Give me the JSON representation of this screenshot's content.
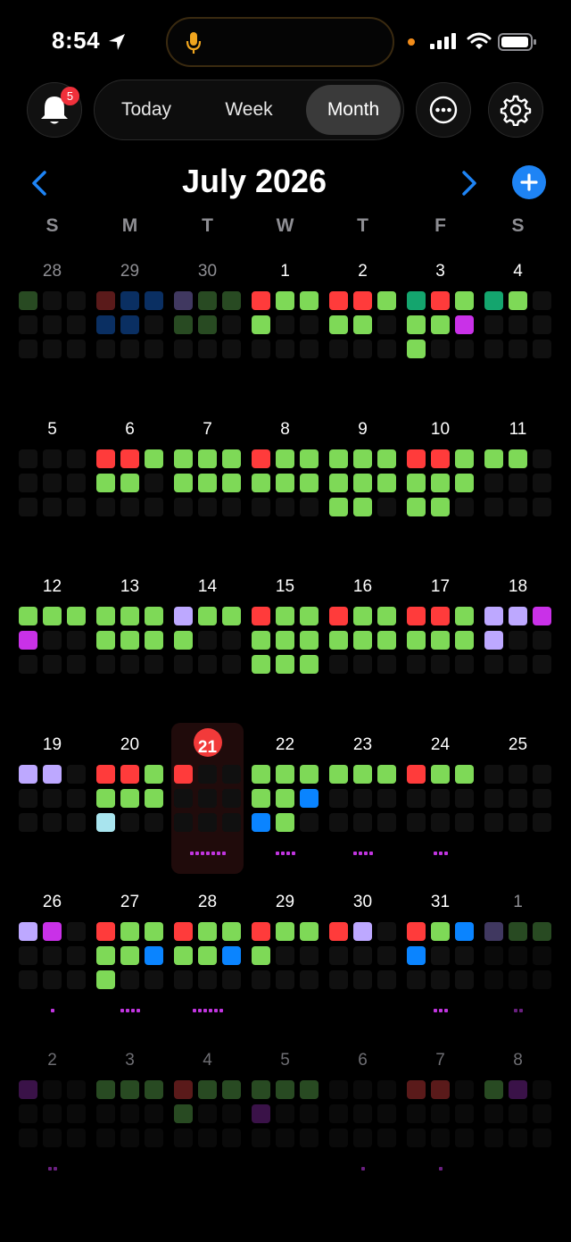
{
  "status_bar": {
    "time": "8:54"
  },
  "toolbar": {
    "notification_count": "5",
    "tabs": [
      "Today",
      "Week",
      "Month"
    ],
    "selected_tab": "Month"
  },
  "calendar": {
    "month_title": "July 2026",
    "weekdays": [
      "S",
      "M",
      "T",
      "W",
      "T",
      "F",
      "S"
    ],
    "today": "21",
    "colors": {
      "r": "#ff3b3b",
      "g": "#7ed957",
      "b": "#0a84ff",
      "L": "#bda8ff",
      "P": "#c931e8",
      "T": "#14a56e",
      "C": "#a8e4ee",
      "e": "#101010",
      "f": "#0a0a0a",
      "mr": "#5a1a1a",
      "mb": "#0a2f62",
      "mg": "#284a22",
      "mL": "#403860",
      "mP": "#3a1248",
      "mT": "#124a30"
    },
    "days": [
      {
        "n": "28",
        "st": "muted",
        "c": [
          "mg",
          "e",
          "e",
          "e",
          "e",
          "e",
          "e",
          "e",
          "e"
        ]
      },
      {
        "n": "29",
        "st": "muted",
        "c": [
          "mr",
          "mb",
          "mb",
          "mb",
          "mb",
          "e",
          "e",
          "e",
          "e"
        ]
      },
      {
        "n": "30",
        "st": "muted",
        "c": [
          "mL",
          "mg",
          "mg",
          "mg",
          "mg",
          "e",
          "e",
          "e",
          "e"
        ]
      },
      {
        "n": "1",
        "c": [
          "r",
          "g",
          "g",
          "g",
          "e",
          "e",
          "e",
          "e",
          "e"
        ]
      },
      {
        "n": "2",
        "c": [
          "r",
          "r",
          "g",
          "g",
          "g",
          "e",
          "e",
          "e",
          "e"
        ]
      },
      {
        "n": "3",
        "c": [
          "T",
          "r",
          "g",
          "g",
          "g",
          "P",
          "g",
          "e",
          "e"
        ]
      },
      {
        "n": "4",
        "c": [
          "T",
          "g",
          "e",
          "e",
          "e",
          "e",
          "e",
          "e",
          "e"
        ]
      },
      {
        "n": "5",
        "c": [
          "e",
          "e",
          "e",
          "e",
          "e",
          "e",
          "e",
          "e",
          "e"
        ]
      },
      {
        "n": "6",
        "c": [
          "r",
          "r",
          "g",
          "g",
          "g",
          "e",
          "e",
          "e",
          "e"
        ]
      },
      {
        "n": "7",
        "c": [
          "g",
          "g",
          "g",
          "g",
          "g",
          "g",
          "e",
          "e",
          "e"
        ]
      },
      {
        "n": "8",
        "c": [
          "r",
          "g",
          "g",
          "g",
          "g",
          "g",
          "e",
          "e",
          "e"
        ]
      },
      {
        "n": "9",
        "c": [
          "g",
          "g",
          "g",
          "g",
          "g",
          "g",
          "g",
          "g",
          "e"
        ]
      },
      {
        "n": "10",
        "c": [
          "r",
          "r",
          "g",
          "g",
          "g",
          "g",
          "g",
          "g",
          "e"
        ]
      },
      {
        "n": "11",
        "c": [
          "g",
          "g",
          "e",
          "e",
          "e",
          "e",
          "e",
          "e",
          "e"
        ]
      },
      {
        "n": "12",
        "c": [
          "g",
          "g",
          "g",
          "P",
          "e",
          "e",
          "e",
          "e",
          "e"
        ]
      },
      {
        "n": "13",
        "c": [
          "g",
          "g",
          "g",
          "g",
          "g",
          "g",
          "e",
          "e",
          "e"
        ]
      },
      {
        "n": "14",
        "c": [
          "L",
          "g",
          "g",
          "g",
          "e",
          "e",
          "e",
          "e",
          "e"
        ]
      },
      {
        "n": "15",
        "c": [
          "r",
          "g",
          "g",
          "g",
          "g",
          "g",
          "g",
          "g",
          "g"
        ]
      },
      {
        "n": "16",
        "c": [
          "r",
          "g",
          "g",
          "g",
          "g",
          "g",
          "e",
          "e",
          "e"
        ]
      },
      {
        "n": "17",
        "c": [
          "r",
          "r",
          "g",
          "g",
          "g",
          "g",
          "e",
          "e",
          "e"
        ]
      },
      {
        "n": "18",
        "c": [
          "L",
          "L",
          "P",
          "L",
          "e",
          "e",
          "e",
          "e",
          "e"
        ]
      },
      {
        "n": "19",
        "c": [
          "L",
          "L",
          "e",
          "e",
          "e",
          "e",
          "e",
          "e",
          "e"
        ]
      },
      {
        "n": "20",
        "c": [
          "r",
          "r",
          "g",
          "g",
          "g",
          "g",
          "C",
          "e",
          "e"
        ]
      },
      {
        "n": "21",
        "st": "today",
        "c": [
          "r",
          "e",
          "e",
          "e",
          "e",
          "e",
          "e",
          "e",
          "e"
        ],
        "dots": 7
      },
      {
        "n": "22",
        "c": [
          "g",
          "g",
          "g",
          "g",
          "g",
          "b",
          "b",
          "g",
          "e"
        ],
        "dots": 4
      },
      {
        "n": "23",
        "c": [
          "g",
          "g",
          "g",
          "e",
          "e",
          "e",
          "e",
          "e",
          "e"
        ],
        "dots": 4
      },
      {
        "n": "24",
        "c": [
          "r",
          "g",
          "g",
          "e",
          "e",
          "e",
          "e",
          "e",
          "e"
        ],
        "dots": 3
      },
      {
        "n": "25",
        "c": [
          "e",
          "e",
          "e",
          "e",
          "e",
          "e",
          "e",
          "e",
          "e"
        ]
      },
      {
        "n": "26",
        "c": [
          "L",
          "P",
          "e",
          "e",
          "e",
          "e",
          "e",
          "e",
          "e"
        ],
        "dots": 1
      },
      {
        "n": "27",
        "c": [
          "r",
          "g",
          "g",
          "g",
          "g",
          "b",
          "g",
          "e",
          "e"
        ],
        "dots": 4
      },
      {
        "n": "28",
        "c": [
          "r",
          "g",
          "g",
          "g",
          "g",
          "b",
          "e",
          "e",
          "e"
        ],
        "dots": 6
      },
      {
        "n": "29",
        "c": [
          "r",
          "g",
          "g",
          "g",
          "e",
          "e",
          "e",
          "e",
          "e"
        ]
      },
      {
        "n": "30",
        "c": [
          "r",
          "L",
          "e",
          "e",
          "e",
          "e",
          "e",
          "e",
          "e"
        ]
      },
      {
        "n": "31",
        "c": [
          "r",
          "g",
          "b",
          "b",
          "e",
          "e",
          "e",
          "e",
          "e"
        ],
        "dots": 3
      },
      {
        "n": "1",
        "st": "muted",
        "c": [
          "mL",
          "mg",
          "mg",
          "f",
          "f",
          "f",
          "f",
          "f",
          "f"
        ],
        "dots": 2
      },
      {
        "n": "2",
        "st": "fade",
        "c": [
          "mP",
          "f",
          "f",
          "f",
          "f",
          "f",
          "f",
          "f",
          "f"
        ],
        "dots": 2
      },
      {
        "n": "3",
        "st": "fade",
        "c": [
          "mg",
          "mg",
          "mg",
          "f",
          "f",
          "f",
          "f",
          "f",
          "f"
        ]
      },
      {
        "n": "4",
        "st": "fade",
        "c": [
          "mr",
          "mg",
          "mg",
          "mg",
          "f",
          "f",
          "f",
          "f",
          "f"
        ]
      },
      {
        "n": "5",
        "st": "fade",
        "c": [
          "mg",
          "mg",
          "mg",
          "mP",
          "f",
          "f",
          "f",
          "f",
          "f"
        ]
      },
      {
        "n": "6",
        "st": "fade",
        "c": [
          "f",
          "f",
          "f",
          "f",
          "f",
          "f",
          "f",
          "f",
          "f"
        ],
        "dots": 1
      },
      {
        "n": "7",
        "st": "fade",
        "c": [
          "mr",
          "mr",
          "f",
          "f",
          "f",
          "f",
          "f",
          "f",
          "f"
        ],
        "dots": 1
      },
      {
        "n": "8",
        "st": "fade",
        "c": [
          "mg",
          "mP",
          "f",
          "f",
          "f",
          "f",
          "f",
          "f",
          "f"
        ]
      }
    ]
  }
}
